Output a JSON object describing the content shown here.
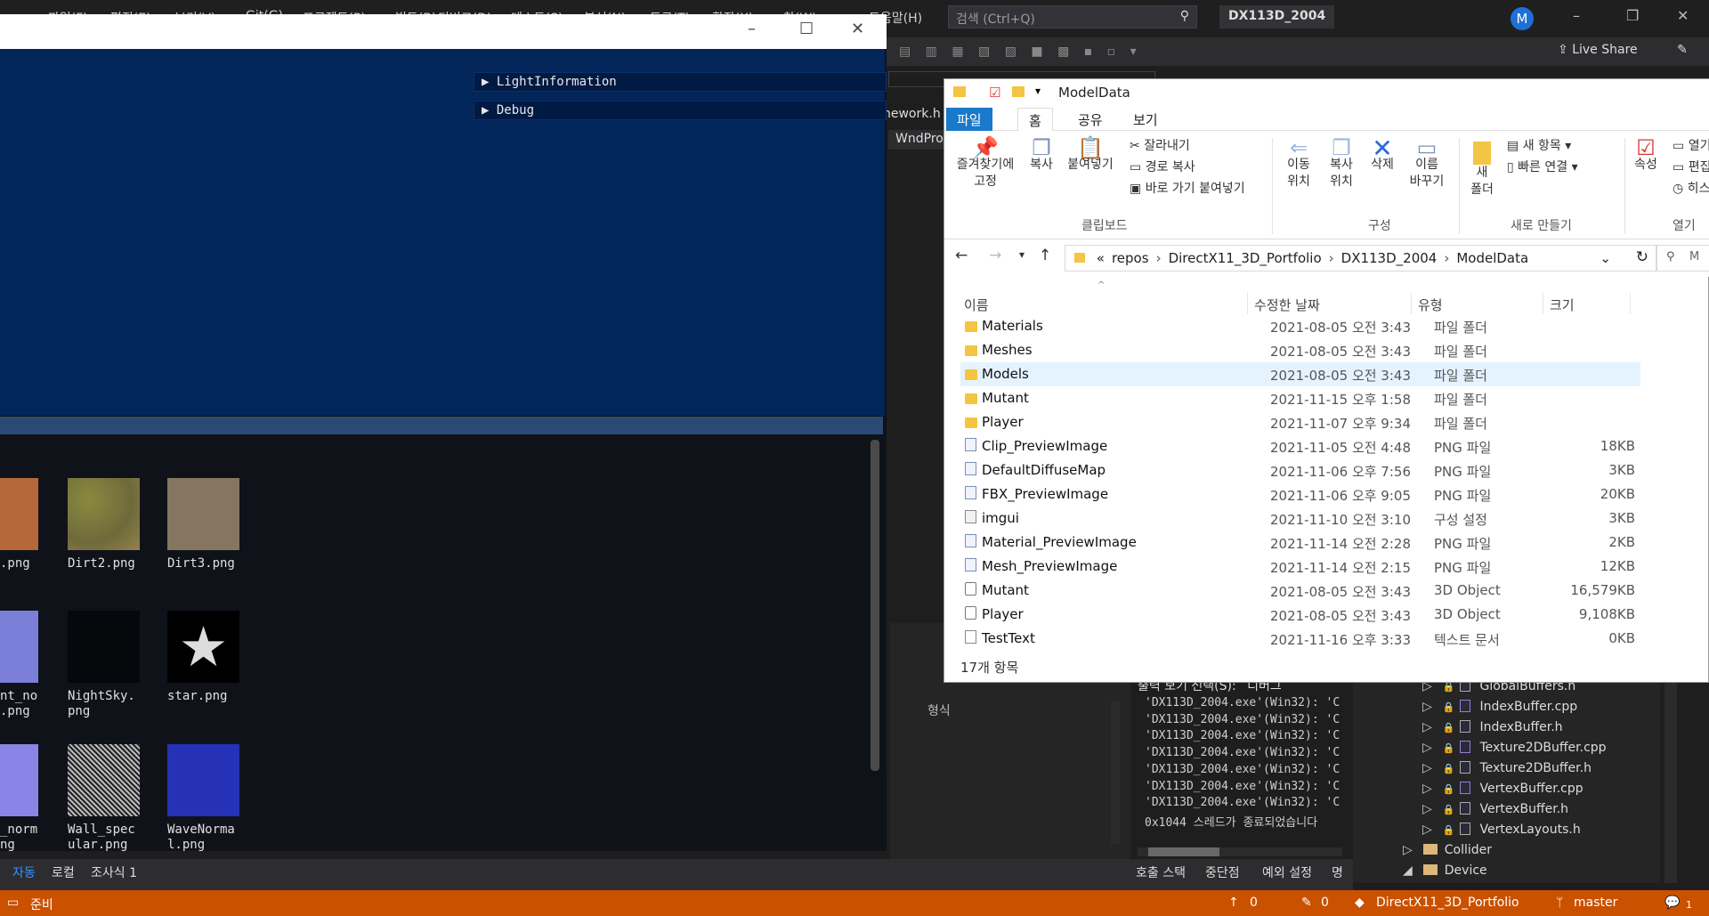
{
  "vs": {
    "menu": [
      "파일(F)",
      "편집(E)",
      "보기(V)",
      "Git(G)",
      "프로젝트(P)",
      "빌드(B)",
      "디버그(D)",
      "테스트(S)",
      "분석(N)",
      "도구(T)",
      "확장(X)",
      "창(W)",
      "도움말(H)"
    ],
    "search_placeholder": "검색 (Ctrl+Q)",
    "project_name": "DX113D_2004",
    "avatar_letter": "M",
    "live_share": "Live Share",
    "tab_partial_1": "nework.h",
    "tab_partial_2": "WndPro",
    "format_label": "형식",
    "output_source_label": "출력 보기 선택(S):",
    "output_source_value": "디버그",
    "output_lines": [
      "'DX113D_2004.exe'(Win32): 'C",
      "'DX113D_2004.exe'(Win32): 'C",
      "'DX113D_2004.exe'(Win32): 'C",
      "'DX113D_2004.exe'(Win32): 'C",
      "'DX113D_2004.exe'(Win32): 'C",
      "'DX113D_2004.exe'(Win32): 'C",
      "'DX113D_2004.exe'(Win32): 'C",
      "0x1044 스레드가 종료되었습니다"
    ],
    "solution_items": [
      {
        "name": "GlobalBuffers.h",
        "kind": "h"
      },
      {
        "name": "IndexBuffer.cpp",
        "kind": "cpp"
      },
      {
        "name": "IndexBuffer.h",
        "kind": "h"
      },
      {
        "name": "Texture2DBuffer.cpp",
        "kind": "cpp"
      },
      {
        "name": "Texture2DBuffer.h",
        "kind": "h"
      },
      {
        "name": "VertexBuffer.cpp",
        "kind": "cpp"
      },
      {
        "name": "VertexBuffer.h",
        "kind": "h"
      },
      {
        "name": "VertexLayouts.h",
        "kind": "h"
      },
      {
        "name": "Collider",
        "kind": "folder"
      },
      {
        "name": "Device",
        "kind": "folder"
      }
    ],
    "bottom_tabs_left": [
      "자동",
      "로컬",
      "조사식 1"
    ],
    "bottom_tabs_right": [
      "호출 스택",
      "중단점",
      "예외 설정",
      "명"
    ],
    "status": {
      "ready": "준비",
      "up_count": "0",
      "pencil_count": "0",
      "repo": "DirectX11_3D_Portfolio",
      "branch": "master",
      "notifications": "1"
    }
  },
  "game": {
    "panels": [
      "LightInformation",
      "Debug"
    ],
    "assets": [
      {
        "label": ".png",
        "color": "#b5683a"
      },
      {
        "label": "Dirt2.png",
        "color": "#7f7a3e"
      },
      {
        "label": "Dirt3.png",
        "color": "#857662"
      },
      {
        "label": "nt_no\n.png",
        "color": "#7b7fd8"
      },
      {
        "label": "NightSky.\npng",
        "color": "#06080c"
      },
      {
        "label": "star.png",
        "color": "#000000"
      },
      {
        "label": "_norm\nng",
        "color": "#8a84e6"
      },
      {
        "label": "Wall_spec\nular.png",
        "color": "#9b9b9b"
      },
      {
        "label": "WaveNorma\nl.png",
        "color": "#2532b8"
      }
    ]
  },
  "explorer": {
    "title": "ModelData",
    "tabs": [
      "파일",
      "홈",
      "공유",
      "보기"
    ],
    "ribbon": {
      "pin": "즐겨찾기에\n고정",
      "copy": "복사",
      "paste": "붙여넣기",
      "cut": "잘라내기",
      "copy_path": "경로 복사",
      "paste_shortcut": "바로 가기 붙여넣기",
      "group_clipboard": "클립보드",
      "move_to": "이동\n위치",
      "copy_to": "복사\n위치",
      "delete": "삭제",
      "rename": "이름\n바꾸기",
      "group_organize": "구성",
      "new_folder": "새\n폴더",
      "new_item": "새 항목",
      "easy_access": "빠른 연결",
      "group_new": "새로 만들기",
      "properties": "속성",
      "open_partial": "열기",
      "edit_partial": "편집",
      "history_partial": "히스",
      "group_open": "열기"
    },
    "breadcrumb": [
      "«",
      "repos",
      "DirectX11_3D_Portfolio",
      "DX113D_2004",
      "ModelData"
    ],
    "search_partial": "M",
    "columns": [
      "이름",
      "수정한 날짜",
      "유형",
      "크기"
    ],
    "files": [
      {
        "name": "Materials",
        "date": "2021-08-05 오전 3:43",
        "type": "파일 폴더",
        "size": "",
        "icon": "folder"
      },
      {
        "name": "Meshes",
        "date": "2021-08-05 오전 3:43",
        "type": "파일 폴더",
        "size": "",
        "icon": "folder"
      },
      {
        "name": "Models",
        "date": "2021-08-05 오전 3:43",
        "type": "파일 폴더",
        "size": "",
        "icon": "folder",
        "selected": true
      },
      {
        "name": "Mutant",
        "date": "2021-11-15 오후 1:58",
        "type": "파일 폴더",
        "size": "",
        "icon": "folder"
      },
      {
        "name": "Player",
        "date": "2021-11-07 오후 9:34",
        "type": "파일 폴더",
        "size": "",
        "icon": "folder"
      },
      {
        "name": "Clip_PreviewImage",
        "date": "2021-11-05 오전 4:48",
        "type": "PNG 파일",
        "size": "18KB",
        "icon": "png"
      },
      {
        "name": "DefaultDiffuseMap",
        "date": "2021-11-06 오후 7:56",
        "type": "PNG 파일",
        "size": "3KB",
        "icon": "png"
      },
      {
        "name": "FBX_PreviewImage",
        "date": "2021-11-06 오후 9:05",
        "type": "PNG 파일",
        "size": "20KB",
        "icon": "png"
      },
      {
        "name": "imgui",
        "date": "2021-11-10 오전 3:10",
        "type": "구성 설정",
        "size": "3KB",
        "icon": "ini"
      },
      {
        "name": "Material_PreviewImage",
        "date": "2021-11-14 오전 2:28",
        "type": "PNG 파일",
        "size": "2KB",
        "icon": "png"
      },
      {
        "name": "Mesh_PreviewImage",
        "date": "2021-11-14 오전 2:15",
        "type": "PNG 파일",
        "size": "12KB",
        "icon": "png"
      },
      {
        "name": "Mutant",
        "date": "2021-08-05 오전 3:43",
        "type": "3D Object",
        "size": "16,579KB",
        "icon": "obj"
      },
      {
        "name": "Player",
        "date": "2021-08-05 오전 3:43",
        "type": "3D Object",
        "size": "9,108KB",
        "icon": "obj"
      },
      {
        "name": "TestText",
        "date": "2021-11-16 오후 3:33",
        "type": "텍스트 문서",
        "size": "0KB",
        "icon": "txt"
      }
    ],
    "status": "17개 항목"
  },
  "colors": {
    "vs_status": "#ca5100",
    "viewport": "#02255a",
    "explorer_tab_active": "#1979ca",
    "selection": "#e5f3ff"
  }
}
